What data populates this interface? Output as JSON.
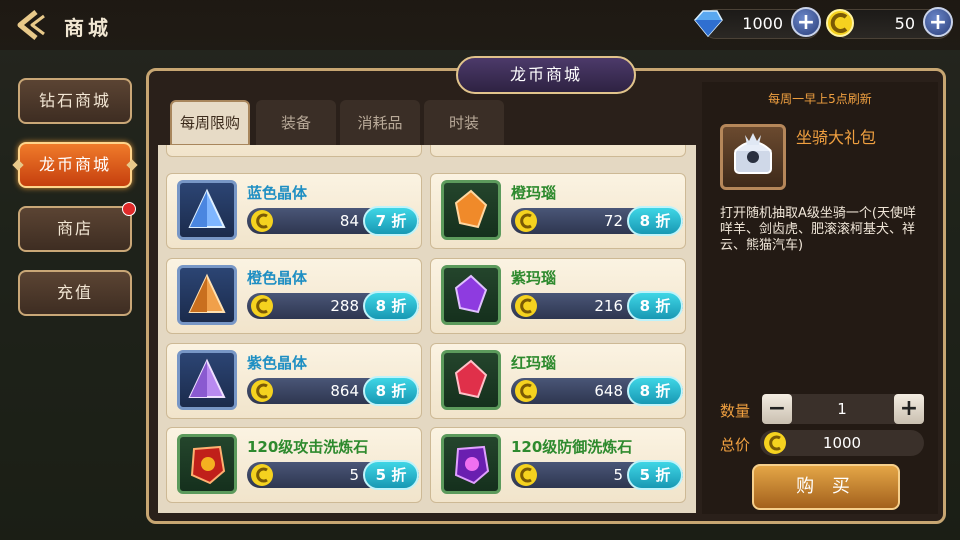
{
  "header": {
    "title": "商城"
  },
  "currency": {
    "gems": "1000",
    "coins": "50"
  },
  "sidebar": {
    "items": [
      {
        "label": "钻石商城"
      },
      {
        "label": "龙币商城"
      },
      {
        "label": "商店"
      },
      {
        "label": "充值"
      }
    ]
  },
  "panel": {
    "title": "龙币商城"
  },
  "tabs": [
    {
      "label": "每周限购"
    },
    {
      "label": "装备"
    },
    {
      "label": "消耗品"
    },
    {
      "label": "时装"
    }
  ],
  "items": [
    {
      "name": "蓝色晶体",
      "price": "84",
      "discount": "7 折"
    },
    {
      "name": "橙玛瑙",
      "price": "72",
      "discount": "8 折"
    },
    {
      "name": "橙色晶体",
      "price": "288",
      "discount": "8 折"
    },
    {
      "name": "紫玛瑙",
      "price": "216",
      "discount": "8 折"
    },
    {
      "name": "紫色晶体",
      "price": "864",
      "discount": "8 折"
    },
    {
      "name": "红玛瑙",
      "price": "648",
      "discount": "8 折"
    },
    {
      "name": "120级攻击洗炼石",
      "price": "5",
      "discount": "5 折"
    },
    {
      "name": "120级防御洗炼石",
      "price": "5",
      "discount": "5 折"
    }
  ],
  "detail": {
    "refresh_note": "每周一早上5点刷新",
    "item_name": "坐骑大礼包",
    "description": "打开随机抽取A级坐骑一个(天使咩咩羊、剑齿虎、肥滚滚柯基犬、祥云、熊猫汽车)",
    "quantity_label": "数量",
    "quantity": "1",
    "total_label": "总价",
    "total": "1000",
    "buy_label": "购 买"
  },
  "colors": {
    "accent": "#f0a040",
    "discount": "#1fb0c9",
    "active_tab": "#f07b2a"
  }
}
